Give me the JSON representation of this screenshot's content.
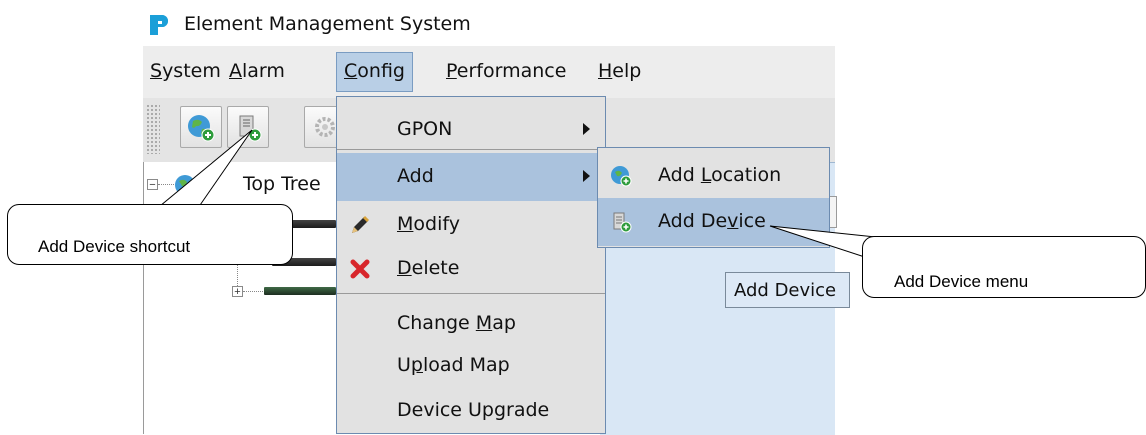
{
  "app": {
    "title": "Element Management System"
  },
  "menubar": {
    "system": "System",
    "alarm": "Alarm",
    "config": "Config",
    "performance": "Performance",
    "help": "Help"
  },
  "tree": {
    "root_label": "Top Tree"
  },
  "config_menu": {
    "items": [
      {
        "label": "GPON",
        "icon": "",
        "has_submenu": true
      },
      {
        "label": "Add",
        "icon": "",
        "has_submenu": true
      },
      {
        "label": "Modify",
        "icon": "pencil-icon"
      },
      {
        "label": "Delete",
        "icon": "red-x-icon"
      },
      {
        "label": "Change Map",
        "icon": ""
      },
      {
        "label": "Upload Map",
        "icon": ""
      },
      {
        "label": "Device Upgrade",
        "icon": ""
      }
    ]
  },
  "add_submenu": {
    "items": [
      {
        "label": "Add Location",
        "icon": "globe-add-icon"
      },
      {
        "label": "Add Device",
        "icon": "device-add-icon"
      }
    ]
  },
  "map": {
    "tooltip": "Add Device"
  },
  "callouts": {
    "shortcut": "Add Device shortcut",
    "menu": "Add Device menu"
  },
  "colors": {
    "highlight": "#aac2dd",
    "menu_bg": "#e2e2e2",
    "map_bg": "#d9e7f5"
  }
}
